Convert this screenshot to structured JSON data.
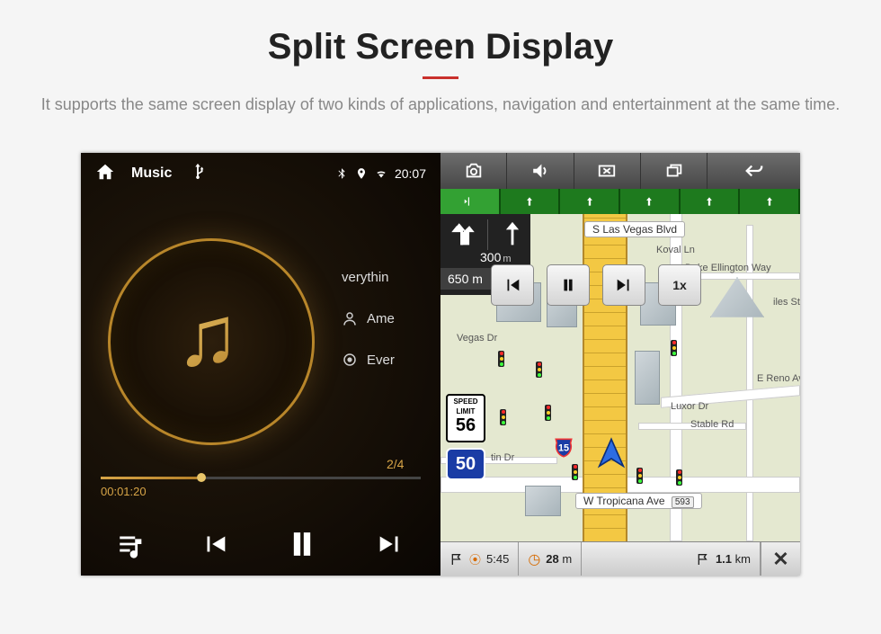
{
  "page": {
    "title": "Split Screen Display",
    "subtitle": "It supports the same screen display of two kinds of applications, navigation and entertainment at the same time."
  },
  "statusbar_time": "20:07",
  "music": {
    "app_label": "Music",
    "title_clip": "verythin",
    "artist_clip": "Ame",
    "extra_clip": "Ever",
    "track_counter": "2/4",
    "elapsed": "00:01:20"
  },
  "nav": {
    "turn_main_dist": "300",
    "turn_main_unit": "m",
    "turn_secondary": "650 m",
    "speed_btn": "1x",
    "speed_limit_label_top": "SPEED",
    "speed_limit_label_bot": "LIMIT",
    "speed_limit_value": "56",
    "current_speed": "50",
    "shield_value": "15",
    "streets": {
      "s_las_vegas": "S Las Vegas Blvd",
      "koval": "Koval Ln",
      "duke": "Duke Ellington Way",
      "giles": "iles St",
      "vegas_dr": "Vegas Dr",
      "reno": "E Reno Av",
      "luxor": "Luxor Dr",
      "stable": "Stable Rd",
      "tin": "tin Dr",
      "tropicana": "W Tropicana Ave",
      "exit": "593"
    },
    "bottom": {
      "eta": "5:45",
      "time_remaining": "28",
      "time_unit": "m",
      "distance": "1.1",
      "distance_unit": "km"
    }
  }
}
